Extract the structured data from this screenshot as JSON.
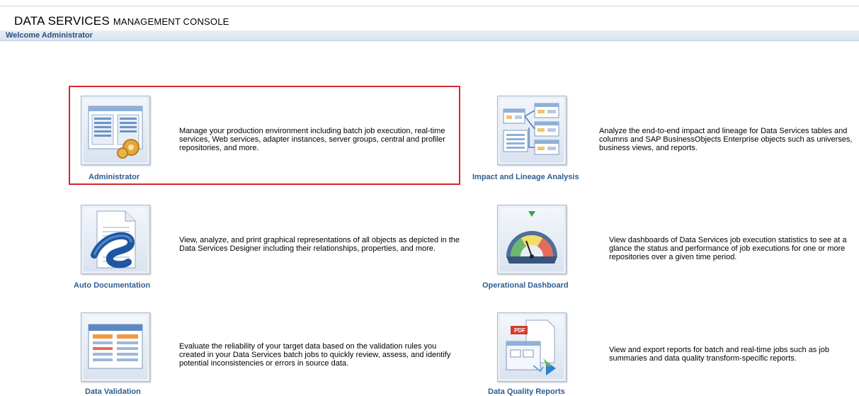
{
  "header": {
    "title_main": "DATA SERVICES",
    "title_rest": "MANAGEMENT CONSOLE",
    "welcome": "Welcome Administrator"
  },
  "modules": [
    {
      "label": "Administrator",
      "icon": "administrator-icon",
      "description": "Manage your production environment including batch job execution, real-time services, Web services, adapter instances, server groups, central and profiler repositories, and more.",
      "selected": true
    },
    {
      "label": "Impact and Lineage Analysis",
      "icon": "impact-lineage-icon",
      "description": "Analyze the end-to-end impact and lineage for Data Services tables and columns and SAP BusinessObjects Enterprise objects such as universes, business views, and reports."
    },
    {
      "label": "Auto Documentation",
      "icon": "auto-documentation-icon",
      "description": "View, analyze, and print graphical representations of all objects as depicted in the Data Services Designer including their relationships, properties, and more."
    },
    {
      "label": "Operational Dashboard",
      "icon": "operational-dashboard-icon",
      "description": "View dashboards of Data Services job execution statistics to see at a glance the status and performance of job executions for one or more repositories over a given time period."
    },
    {
      "label": "Data Validation",
      "icon": "data-validation-icon",
      "description": "Evaluate the reliability of your target data based on the validation rules you created in your Data Services batch jobs to quickly review, assess, and identify potential inconsistencies or errors in source data."
    },
    {
      "label": "Data Quality Reports",
      "icon": "data-quality-reports-icon",
      "description": "View and export reports for batch and real-time jobs such as job summaries and data quality transform-specific reports.",
      "badge": "PDF"
    }
  ],
  "colors": {
    "link": "#2f5d8f",
    "selection": "#d9262d",
    "welcome_text": "#2c4f7c"
  }
}
